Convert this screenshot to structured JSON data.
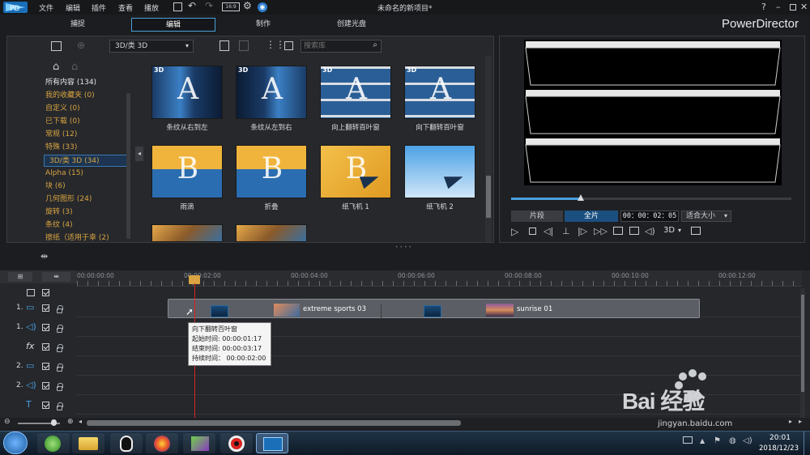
{
  "app": {
    "project_title": "未命名的新项目*",
    "brand": "PowerDirector",
    "help": "?"
  },
  "menu": [
    "文件",
    "编辑",
    "插件",
    "查看",
    "播放"
  ],
  "modes": [
    "捕捉",
    "编辑",
    "制作",
    "创建光盘"
  ],
  "library": {
    "category_select": "3D/类 3D",
    "search_placeholder": "搜索库",
    "categories": [
      {
        "label": "所有内容 (134)",
        "white": true
      },
      {
        "label": "我的收藏夹  (0)"
      },
      {
        "label": "自定义  (0)"
      },
      {
        "label": "已下载  (0)"
      },
      {
        "label": "常规  (12)"
      },
      {
        "label": "特殊  (33)"
      },
      {
        "label": "3D/类 3D  (34)",
        "selected": true
      },
      {
        "label": "Alpha  (15)"
      },
      {
        "label": "块  (6)"
      },
      {
        "label": "几何图形  (24)"
      },
      {
        "label": "旋转  (3)"
      },
      {
        "label": "条纹  (4)"
      },
      {
        "label": "擦纸（适用于幸  (2)"
      }
    ],
    "thumbnails": [
      {
        "label": "条纹从右到左",
        "badge": "3D"
      },
      {
        "label": "条纹从左到右",
        "badge": "3D"
      },
      {
        "label": "向上翻转百叶窗",
        "badge": "3D"
      },
      {
        "label": "向下翻转百叶窗",
        "badge": "3D"
      },
      {
        "label": "雨滴",
        "badge": ""
      },
      {
        "label": "折叠",
        "badge": ""
      },
      {
        "label": "纸飞机 1",
        "badge": ""
      },
      {
        "label": "纸飞机 2",
        "badge": ""
      }
    ]
  },
  "preview": {
    "clip_label": "片段",
    "movie_label": "全片",
    "timecode": "00：00：02：05",
    "fit_label": "适合大小",
    "mode_3d": "3D",
    "scrub_progress": 0.32
  },
  "timeline": {
    "ruler": [
      "00:00:00:00",
      "00:00:02:00",
      "00:00:04:00",
      "00:00:06:00",
      "00:00:08:00",
      "00:00:10:00",
      "00:00:12:00"
    ],
    "tracks": [
      {
        "num": "1.",
        "type": "video"
      },
      {
        "num": "1.",
        "type": "audio"
      },
      {
        "num": "",
        "type": "fx"
      },
      {
        "num": "2.",
        "type": "video"
      },
      {
        "num": "2.",
        "type": "audio"
      },
      {
        "num": "",
        "type": "title"
      }
    ],
    "clips": [
      {
        "label": "extreme sports 03"
      },
      {
        "label": "sunrise 01"
      }
    ],
    "tooltip": {
      "title": "向下翻转百叶窗",
      "start": "起始时间: 00:00:01:17",
      "end": "结束时间: 00:00:03:17",
      "duration": "持续时间：  00:00:02:00"
    }
  },
  "taskbar": {
    "time": "20:01",
    "date": "2018/12/23"
  },
  "watermark": {
    "text": "Bai 经验",
    "url": "jingyan.baidu.com"
  }
}
